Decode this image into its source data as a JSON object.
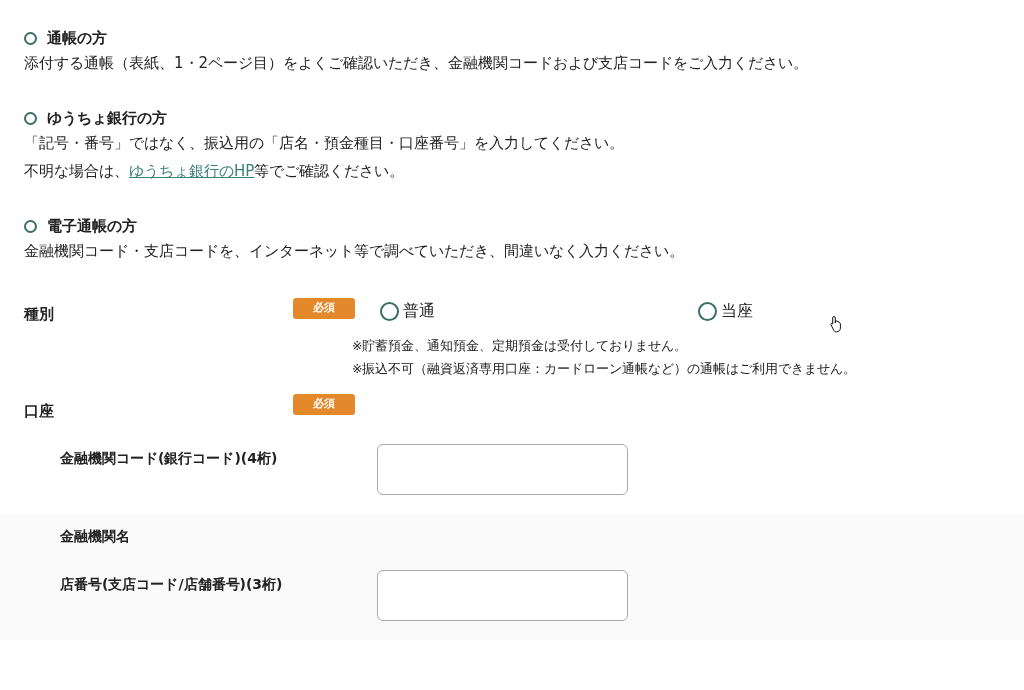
{
  "sections": [
    {
      "title": "通帳の方",
      "lines": [
        [
          {
            "text": "添付する通帳（表紙、1・2ページ目）をよくご確認いただき、金融機関コードおよび支店コードをご入力ください。"
          }
        ]
      ]
    },
    {
      "title": "ゆうちょ銀行の方",
      "lines": [
        [
          {
            "text": "「記号・番号」ではなく、振込用の「店名・預金種目・口座番号」を入力してください。"
          }
        ],
        [
          {
            "text": "不明な場合は、"
          },
          {
            "text": "ゆうちょ銀行のHP",
            "kind": "link"
          },
          {
            "text": "等でご確認ください。"
          }
        ]
      ]
    },
    {
      "title": "電子通帳の方",
      "lines": [
        [
          {
            "text": "金融機関コード・支店コードを、インターネット等で調べていただき、間違いなく入力ください。"
          }
        ]
      ]
    }
  ],
  "account_type": {
    "label": "種別",
    "badge": "必須",
    "options": [
      {
        "label": "普通",
        "selected": false
      },
      {
        "label": "当座",
        "selected": false
      }
    ],
    "notes": [
      "※貯蓄預金、通知預金、定期預金は受付しておりません。",
      "※振込不可（融資返済専用口座：カードローン通帳など）の通帳はご利用できません。"
    ]
  },
  "account": {
    "label": "口座",
    "badge": "必須",
    "fields": [
      {
        "label": "金融機関コード(銀行コード)(4桁)",
        "kind": "input"
      },
      {
        "label": "金融機関名",
        "kind": "text"
      },
      {
        "label": "店番号(支店コード/店舗番号)(3桁)",
        "kind": "input"
      }
    ]
  }
}
